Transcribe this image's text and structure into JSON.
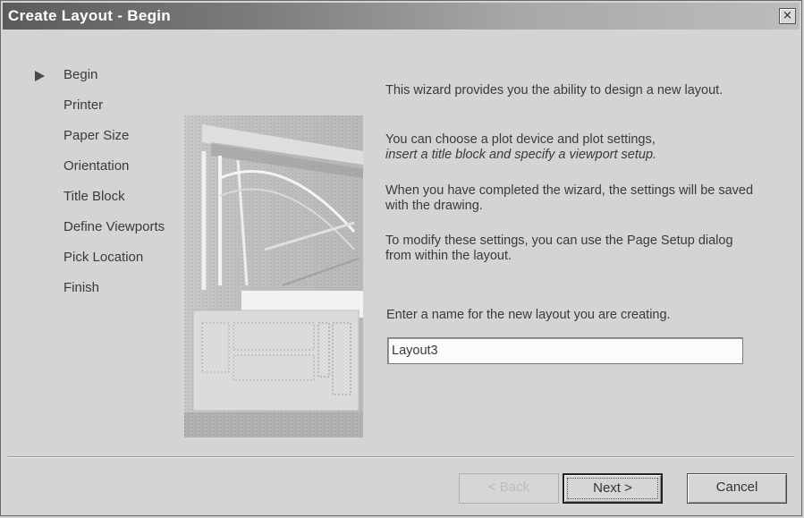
{
  "window": {
    "title": "Create Layout - Begin",
    "close_glyph": "×"
  },
  "steps": {
    "current_index": 0,
    "items": [
      {
        "label": "Begin"
      },
      {
        "label": "Printer"
      },
      {
        "label": "Paper Size"
      },
      {
        "label": "Orientation"
      },
      {
        "label": "Title Block"
      },
      {
        "label": "Define Viewports"
      },
      {
        "label": "Pick Location"
      },
      {
        "label": "Finish"
      }
    ]
  },
  "content": {
    "paragraph1": "This wizard provides you the ability to design a new layout.",
    "paragraph2_plain": "You can choose a plot device and plot settings,",
    "paragraph2_italic": "insert a title block and specify a viewport setup.",
    "paragraph3": "When you have completed the wizard, the settings will be saved with the drawing.",
    "paragraph4": "To modify these settings, you can use the Page Setup dialog from within the layout.",
    "name_prompt": "Enter a name for the new layout you are creating.",
    "name_value": "Layout3"
  },
  "buttons": {
    "back": "< Back",
    "next": "Next >",
    "cancel": "Cancel"
  },
  "icons": {
    "current_step": "triangle-right-icon",
    "close": "close-icon"
  },
  "colors": {
    "title_dark": "#5b5b5b",
    "title_light": "#bdbdbd",
    "dialog_bg": "#d4d4d4"
  }
}
